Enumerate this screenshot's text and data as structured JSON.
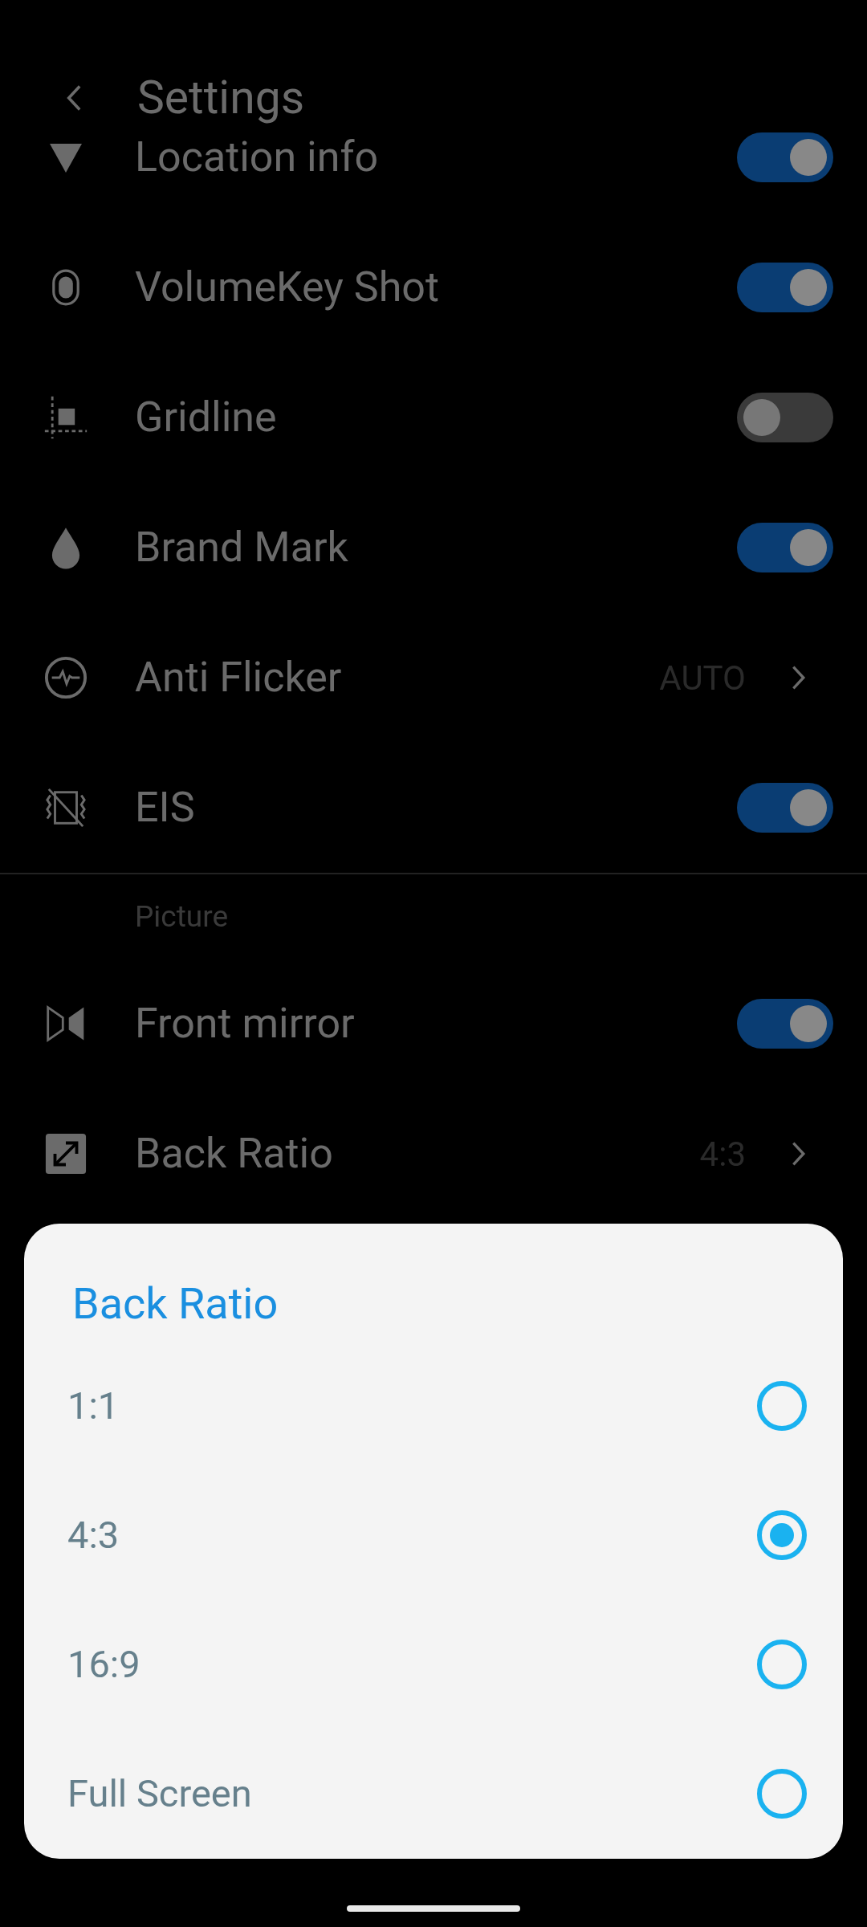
{
  "header": {
    "title": "Settings"
  },
  "settings": [
    {
      "kind": "toggle",
      "label": "Location info",
      "on": true
    },
    {
      "kind": "toggle",
      "label": "VolumeKey Shot",
      "on": true
    },
    {
      "kind": "toggle",
      "label": "Gridline",
      "on": false
    },
    {
      "kind": "toggle",
      "label": "Brand Mark",
      "on": true
    },
    {
      "kind": "value",
      "label": "Anti Flicker",
      "value": "AUTO"
    },
    {
      "kind": "toggle",
      "label": "EIS",
      "on": true
    },
    {
      "kind": "section",
      "label": "Picture"
    },
    {
      "kind": "toggle",
      "label": "Front mirror",
      "on": true
    },
    {
      "kind": "value",
      "label": "Back Ratio",
      "value": "4:3"
    }
  ],
  "dialog": {
    "title": "Back Ratio",
    "options": [
      {
        "label": "1:1",
        "selected": false
      },
      {
        "label": "4:3",
        "selected": true
      },
      {
        "label": "16:9",
        "selected": false
      },
      {
        "label": "Full Screen",
        "selected": false
      }
    ]
  }
}
